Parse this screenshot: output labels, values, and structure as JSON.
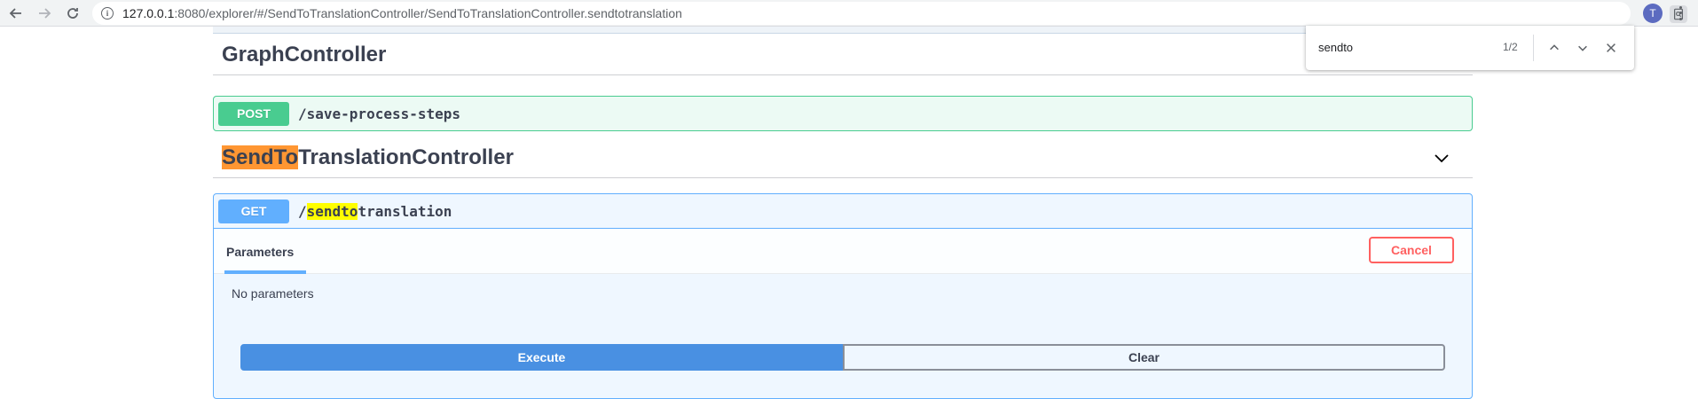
{
  "browser": {
    "url_host": "127.0.0.1",
    "url_rest": ":8080/explorer/#/SendToTranslationController/SendToTranslationController.sendtotranslation",
    "avatar_letter": "T"
  },
  "findbar": {
    "query": "sendto",
    "count": "1/2"
  },
  "sections": {
    "graph": {
      "title": "GraphController",
      "operation": {
        "method": "POST",
        "path": "/save-process-steps"
      }
    },
    "sendto": {
      "title_match": "SendTo",
      "title_rest": "TranslationController",
      "operation": {
        "method": "GET",
        "path_prefix": "/",
        "path_match": "sendto",
        "path_rest": "translation",
        "tab_label": "Parameters",
        "cancel_label": "Cancel",
        "no_params_text": "No parameters",
        "execute_label": "Execute",
        "clear_label": "Clear"
      }
    }
  },
  "colors": {
    "post": "#49cc90",
    "get": "#61affe",
    "execute": "#4990e2",
    "cancel": "#ff6060",
    "find_active_highlight": "#ff9632",
    "find_highlight": "#ffff00"
  },
  "icons": [
    "back-arrow-icon",
    "forward-arrow-icon",
    "reload-icon",
    "info-icon",
    "find-in-page-icon",
    "star-icon",
    "menu-dots-icon",
    "chevron-up-icon",
    "chevron-down-icon",
    "close-icon"
  ]
}
